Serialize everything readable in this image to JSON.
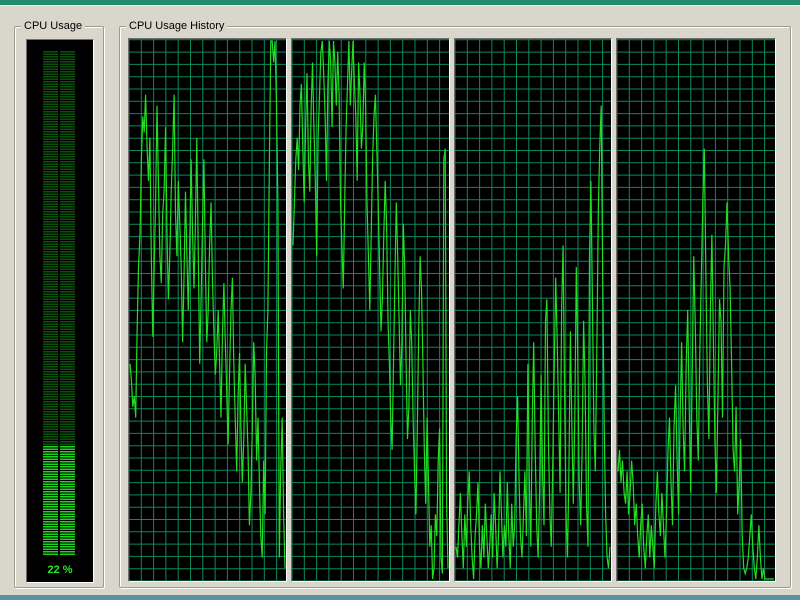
{
  "window": {
    "background": "#d9d6cc"
  },
  "cpu_usage": {
    "title": "CPU Usage",
    "percent": 22,
    "percent_label": "22 %",
    "bar_color": "#1fd21f",
    "dim_color": "#0d4f0d"
  },
  "cpu_history": {
    "title": "CPU Usage History",
    "grid_color": "#0c8a5a",
    "line_color": "#22dd22",
    "panels": [
      {
        "name": "core-0",
        "values": [
          40,
          37,
          32,
          34,
          30,
          46,
          58,
          64,
          78,
          86,
          83,
          90,
          80,
          74,
          82,
          60,
          45,
          58,
          70,
          88,
          74,
          60,
          55,
          68,
          72,
          84,
          64,
          52,
          60,
          72,
          80,
          90,
          68,
          60,
          74,
          66,
          58,
          44,
          56,
          72,
          60,
          50,
          62,
          78,
          64,
          54,
          66,
          82,
          60,
          40,
          52,
          66,
          78,
          58,
          44,
          50,
          62,
          70,
          55,
          46,
          38,
          42,
          50,
          40,
          30,
          45,
          55,
          44,
          35,
          25,
          38,
          50,
          56,
          40,
          30,
          20,
          34,
          42,
          28,
          18,
          26,
          40,
          32,
          24,
          10,
          16,
          28,
          44,
          38,
          22,
          30,
          18,
          8,
          4,
          22,
          12,
          42,
          50,
          78,
          100,
          100,
          96,
          100,
          88,
          70,
          4,
          20,
          30,
          12,
          2
        ]
      },
      {
        "name": "core-1",
        "values": [
          62,
          70,
          78,
          82,
          76,
          88,
          92,
          80,
          70,
          84,
          94,
          78,
          72,
          88,
          96,
          84,
          74,
          60,
          82,
          90,
          98,
          100,
          94,
          86,
          74,
          92,
          100,
          96,
          84,
          100,
          96,
          88,
          98,
          90,
          70,
          62,
          54,
          70,
          84,
          92,
          100,
          88,
          94,
          100,
          92,
          86,
          74,
          96,
          90,
          80,
          84,
          96,
          88,
          70,
          60,
          50,
          64,
          78,
          86,
          90,
          80,
          70,
          58,
          46,
          52,
          64,
          74,
          66,
          48,
          40,
          30,
          24,
          40,
          56,
          70,
          60,
          48,
          36,
          44,
          66,
          58,
          40,
          26,
          32,
          50,
          44,
          30,
          20,
          12,
          28,
          46,
          60,
          54,
          40,
          24,
          14,
          30,
          18,
          6,
          10,
          0,
          2,
          12,
          8,
          22,
          28,
          4,
          1,
          78,
          80,
          14,
          2
        ]
      },
      {
        "name": "core-2",
        "values": [
          6,
          4,
          10,
          16,
          8,
          2,
          12,
          6,
          14,
          20,
          10,
          4,
          0,
          8,
          12,
          18,
          6,
          2,
          10,
          4,
          14,
          8,
          2,
          6,
          12,
          4,
          16,
          10,
          2,
          8,
          20,
          12,
          4,
          10,
          6,
          18,
          8,
          2,
          14,
          6,
          10,
          26,
          34,
          18,
          8,
          4,
          12,
          20,
          8,
          40,
          18,
          6,
          30,
          44,
          24,
          10,
          4,
          16,
          38,
          20,
          10,
          48,
          52,
          26,
          12,
          6,
          22,
          40,
          56,
          44,
          30,
          16,
          50,
          62,
          36,
          12,
          4,
          20,
          46,
          28,
          14,
          30,
          58,
          42,
          18,
          10,
          24,
          48,
          36,
          14,
          6,
          60,
          74,
          52,
          28,
          20,
          42,
          68,
          80,
          88,
          56,
          30,
          12,
          4,
          2,
          6
        ]
      },
      {
        "name": "core-3",
        "values": [
          20,
          24,
          18,
          22,
          16,
          14,
          20,
          12,
          16,
          22,
          18,
          10,
          14,
          8,
          4,
          10,
          14,
          6,
          2,
          8,
          12,
          4,
          10,
          6,
          2,
          14,
          20,
          12,
          8,
          16,
          10,
          4,
          12,
          24,
          30,
          18,
          10,
          28,
          36,
          22,
          12,
          30,
          44,
          28,
          20,
          40,
          50,
          32,
          16,
          38,
          60,
          48,
          30,
          22,
          42,
          56,
          70,
          80,
          58,
          36,
          26,
          50,
          64,
          44,
          26,
          16,
          34,
          52,
          48,
          30,
          58,
          62,
          70,
          60,
          54,
          40,
          24,
          20,
          32,
          12,
          18,
          26,
          8,
          2,
          1,
          2,
          4,
          8,
          12,
          6,
          2,
          0,
          4,
          10,
          4,
          0,
          2,
          0,
          0,
          0,
          0,
          0,
          0,
          0
        ]
      }
    ]
  }
}
